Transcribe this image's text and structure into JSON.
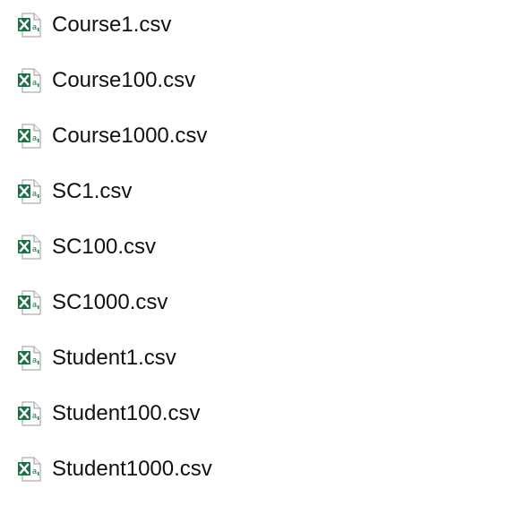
{
  "files": [
    {
      "name": "Course1.csv",
      "icon": "excel-csv-icon"
    },
    {
      "name": "Course100.csv",
      "icon": "excel-csv-icon"
    },
    {
      "name": "Course1000.csv",
      "icon": "excel-csv-icon"
    },
    {
      "name": "SC1.csv",
      "icon": "excel-csv-icon"
    },
    {
      "name": "SC100.csv",
      "icon": "excel-csv-icon"
    },
    {
      "name": "SC1000.csv",
      "icon": "excel-csv-icon"
    },
    {
      "name": "Student1.csv",
      "icon": "excel-csv-icon"
    },
    {
      "name": "Student100.csv",
      "icon": "excel-csv-icon"
    },
    {
      "name": "Student1000.csv",
      "icon": "excel-csv-icon"
    }
  ],
  "colors": {
    "excel_green": "#1D7044",
    "page_fold": "#9a9a9a",
    "text": "#111111"
  }
}
